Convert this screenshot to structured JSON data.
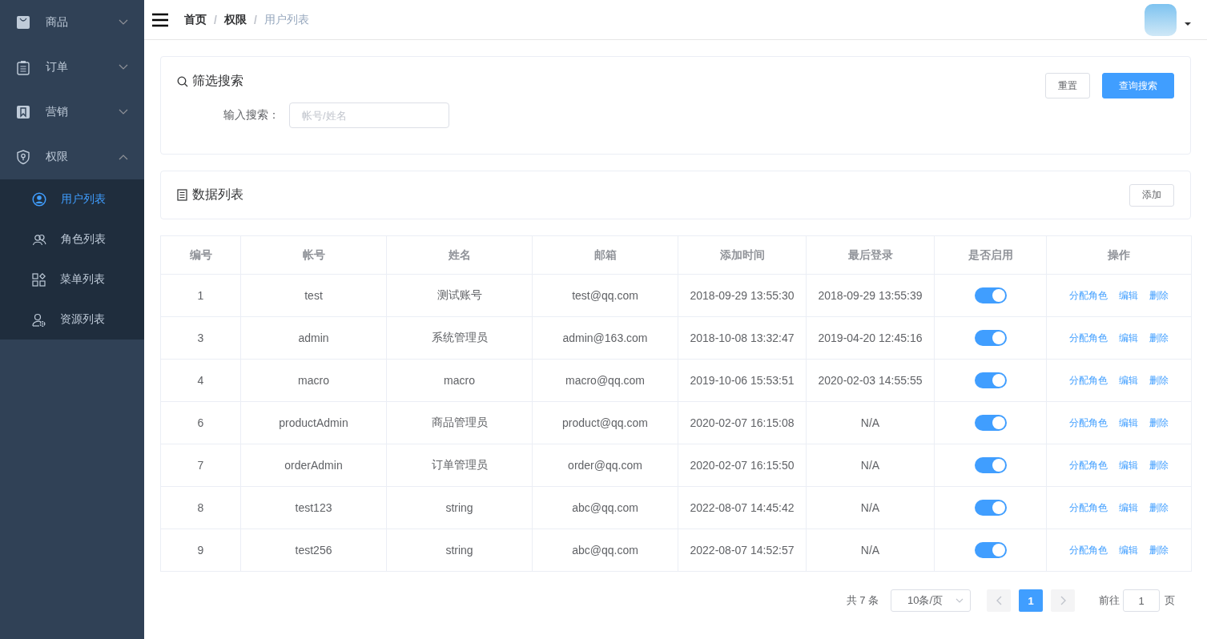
{
  "sidebar": {
    "items": [
      {
        "label": "商品",
        "expanded": false
      },
      {
        "label": "订单",
        "expanded": false
      },
      {
        "label": "营销",
        "expanded": false
      },
      {
        "label": "权限",
        "expanded": true,
        "children": [
          {
            "label": "用户列表",
            "selected": true
          },
          {
            "label": "角色列表",
            "selected": false
          },
          {
            "label": "菜单列表",
            "selected": false
          },
          {
            "label": "资源列表",
            "selected": false
          }
        ]
      }
    ]
  },
  "header": {
    "separators": [
      "/",
      "/"
    ],
    "breadcrumb": [
      {
        "label": "首页",
        "current": false
      },
      {
        "label": "权限",
        "current": false
      },
      {
        "label": "用户列表",
        "current": true
      }
    ]
  },
  "filter": {
    "title": "筛选搜索",
    "label": "输入搜索：",
    "placeholder": "帐号/姓名",
    "buttons": [
      {
        "label": "重置",
        "kind": "plain"
      },
      {
        "label": "查询搜索",
        "kind": "primary"
      }
    ]
  },
  "list": {
    "title": "数据列表",
    "add_button": "添加"
  },
  "table": {
    "columns": [
      "编号",
      "帐号",
      "姓名",
      "邮箱",
      "添加时间",
      "最后登录",
      "是否启用",
      "操作"
    ],
    "rows": [
      {
        "cells": [
          "1",
          "test",
          "测试账号",
          "test@qq.com",
          "2018-09-29 13:55:30",
          "2018-09-29 13:55:39"
        ],
        "enabled": true,
        "actions": [
          "分配角色",
          "编辑",
          "删除"
        ]
      },
      {
        "cells": [
          "3",
          "admin",
          "系统管理员",
          "admin@163.com",
          "2018-10-08 13:32:47",
          "2019-04-20 12:45:16"
        ],
        "enabled": true,
        "actions": [
          "分配角色",
          "编辑",
          "删除"
        ]
      },
      {
        "cells": [
          "4",
          "macro",
          "macro",
          "macro@qq.com",
          "2019-10-06 15:53:51",
          "2020-02-03 14:55:55"
        ],
        "enabled": true,
        "actions": [
          "分配角色",
          "编辑",
          "删除"
        ]
      },
      {
        "cells": [
          "6",
          "productAdmin",
          "商品管理员",
          "product@qq.com",
          "2020-02-07 16:15:08",
          "N/A"
        ],
        "enabled": true,
        "actions": [
          "分配角色",
          "编辑",
          "删除"
        ]
      },
      {
        "cells": [
          "7",
          "orderAdmin",
          "订单管理员",
          "order@qq.com",
          "2020-02-07 16:15:50",
          "N/A"
        ],
        "enabled": true,
        "actions": [
          "分配角色",
          "编辑",
          "删除"
        ]
      },
      {
        "cells": [
          "8",
          "test123",
          "string",
          "abc@qq.com",
          "2022-08-07 14:45:42",
          "N/A"
        ],
        "enabled": true,
        "actions": [
          "分配角色",
          "编辑",
          "删除"
        ]
      },
      {
        "cells": [
          "9",
          "test256",
          "string",
          "abc@qq.com",
          "2022-08-07 14:52:57",
          "N/A"
        ],
        "enabled": true,
        "actions": [
          "分配角色",
          "编辑",
          "删除"
        ]
      }
    ]
  },
  "pagination": {
    "total": "共 7 条",
    "page_size": "10条/页",
    "pages": [
      {
        "label": "1",
        "selected": true
      }
    ],
    "goto_label": "前往",
    "goto_value": "1",
    "page_suffix": "页"
  }
}
